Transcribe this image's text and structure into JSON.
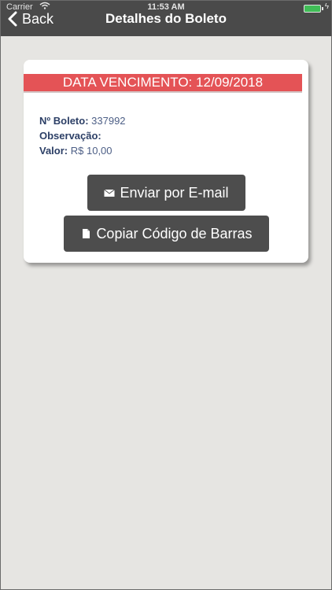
{
  "status_bar": {
    "carrier": "Carrier",
    "time": "11:53 AM",
    "battery_color": "#3fd25a"
  },
  "navbar": {
    "back_label": "Back",
    "title": "Detalhes do Boleto",
    "back_icon": "chevron-left-icon"
  },
  "card": {
    "due_date_text": "DATA VENCIMENTO: 12/09/2018",
    "banner_color": "#e45356",
    "fields": [
      {
        "label": "Nº Boleto:",
        "value": "337992"
      },
      {
        "label": "Observação:",
        "value": ""
      },
      {
        "label": "Valor:",
        "value": "R$ 10,00"
      }
    ],
    "email_button": {
      "label": "Enviar por E-mail",
      "icon": "envelope-icon"
    },
    "copy_button": {
      "label": "Copiar Código de Barras",
      "icon": "document-icon"
    }
  }
}
